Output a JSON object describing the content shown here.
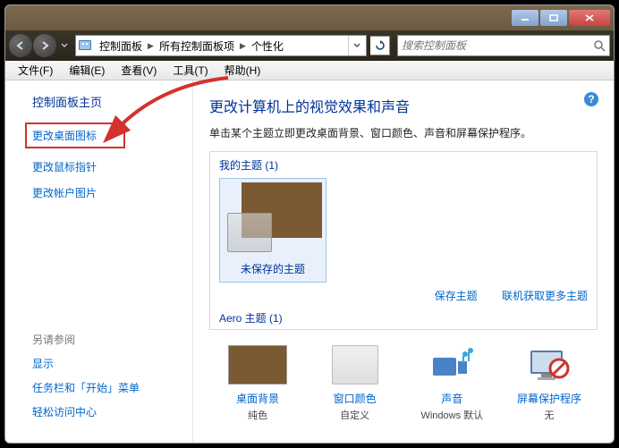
{
  "breadcrumb": {
    "items": [
      "控制面板",
      "所有控制面板项",
      "个性化"
    ]
  },
  "search": {
    "placeholder": "搜索控制面板"
  },
  "menu": {
    "file": "文件(F)",
    "edit": "编辑(E)",
    "view": "查看(V)",
    "tool": "工具(T)",
    "help": "帮助(H)"
  },
  "sidebar": {
    "home": "控制面板主页",
    "links": [
      "更改桌面图标",
      "更改鼠标指针",
      "更改帐户图片"
    ],
    "see_also": "另请参阅",
    "see_links": [
      "显示",
      "任务栏和「开始」菜单",
      "轻松访问中心"
    ]
  },
  "main": {
    "title": "更改计算机上的视觉效果和声音",
    "desc": "单击某个主题立即更改桌面背景、窗口颜色、声音和屏幕保护程序。",
    "my_themes": "我的主题 (1)",
    "unsaved_theme": "未保存的主题",
    "save_theme": "保存主题",
    "get_online": "联机获取更多主题",
    "aero": "Aero 主题 (1)"
  },
  "bottom": {
    "desktop_bg": {
      "label": "桌面背景",
      "sub": "纯色"
    },
    "window_color": {
      "label": "窗口颜色",
      "sub": "自定义"
    },
    "sound": {
      "label": "声音",
      "sub": "Windows 默认"
    },
    "screensaver": {
      "label": "屏幕保护程序",
      "sub": "无"
    }
  },
  "colors": {
    "accent": "#003399",
    "link": "#0066cc",
    "annotation": "#d3322d",
    "brown": "#7a5a33"
  }
}
